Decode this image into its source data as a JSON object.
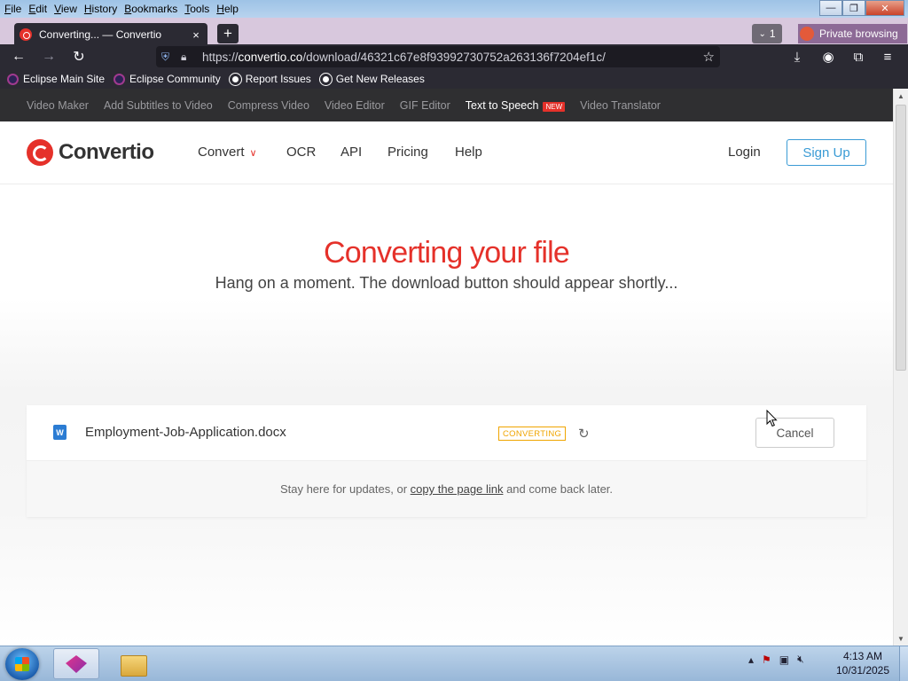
{
  "menubar": {
    "items": [
      "File",
      "Edit",
      "View",
      "History",
      "Bookmarks",
      "Tools",
      "Help"
    ]
  },
  "window_controls": {
    "minimize": "—",
    "restore": "❐",
    "close": "✕"
  },
  "tabs": {
    "active_title": "Converting... — Convertio",
    "close_glyph": "×",
    "new_tab_glyph": "+",
    "tab_count": "1",
    "private_label": "Private browsing"
  },
  "nav": {
    "url_prefix": "https://",
    "url_host": "convertio.co",
    "url_path": "/download/46321c67e8f93992730752a263136f7204ef1c/"
  },
  "bookmarks": [
    {
      "label": "Eclipse Main Site",
      "icon": "eclipse-icon"
    },
    {
      "label": "Eclipse Community",
      "icon": "eclipse-icon"
    },
    {
      "label": "Report Issues",
      "icon": "github-icon"
    },
    {
      "label": "Get New Releases",
      "icon": "github-icon"
    }
  ],
  "site": {
    "top_links": [
      "Video Maker",
      "Add Subtitles to Video",
      "Compress Video",
      "Video Editor",
      "GIF Editor",
      "Text to Speech",
      "Video Translator"
    ],
    "new_badge": "NEW",
    "logo_text": "Convertio",
    "nav": {
      "convert": "Convert",
      "ocr": "OCR",
      "api": "API",
      "pricing": "Pricing",
      "help": "Help"
    },
    "login": "Login",
    "signup": "Sign Up"
  },
  "main": {
    "headline": "Converting your file",
    "subline": "Hang on a moment. The download button should appear shortly...",
    "file": {
      "name": "Employment-Job-Application.docx",
      "icon_letter": "W",
      "status": "CONVERTING",
      "cancel": "Cancel"
    },
    "stay": {
      "before": "Stay here for updates, or ",
      "link": "copy the page link",
      "after": " and come back later."
    }
  },
  "taskbar": {
    "clock_time": "4:13 AM",
    "clock_date": "10/31/2025"
  },
  "colors": {
    "brand_red": "#e5312a",
    "signup_blue": "#3a9bd5",
    "converting_amber": "#f0a500",
    "browser_dark": "#2b2a33"
  }
}
